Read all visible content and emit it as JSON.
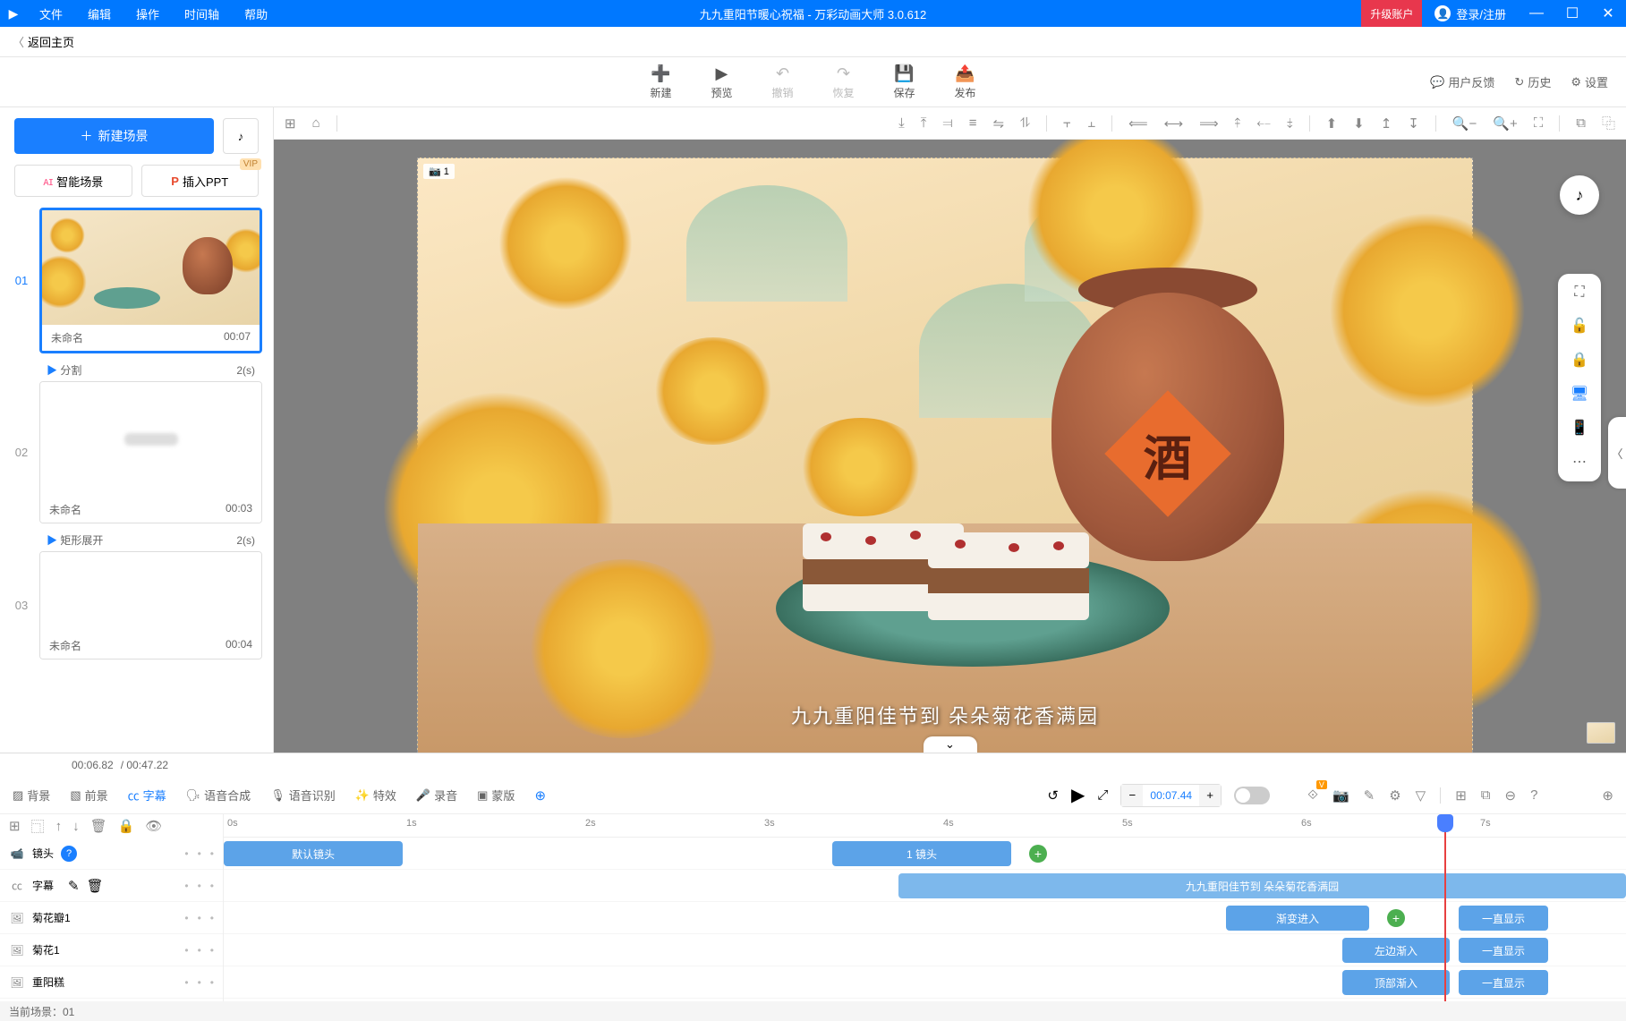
{
  "titlebar": {
    "menus": [
      "文件",
      "编辑",
      "操作",
      "时间轴",
      "帮助"
    ],
    "title": "九九重阳节暖心祝福 - 万彩动画大师 3.0.612",
    "upgrade": "升级账户",
    "login": "登录/注册"
  },
  "back": {
    "label": "返回主页"
  },
  "toolbar": {
    "new": "新建",
    "preview": "预览",
    "undo": "撤销",
    "redo": "恢复",
    "save": "保存",
    "publish": "发布",
    "feedback": "用户反馈",
    "history": "历史",
    "settings": "设置"
  },
  "left": {
    "new_scene": "新建场景",
    "smart_scene": "智能场景",
    "insert_ppt": "插入PPT",
    "vip": "VIP",
    "scenes": [
      {
        "idx": "01",
        "name": "未命名",
        "duration": "00:07",
        "selected": true,
        "blank": false,
        "transition": {
          "name": "分割",
          "duration": "2(s)"
        }
      },
      {
        "idx": "02",
        "name": "未命名",
        "duration": "00:03",
        "selected": false,
        "blank": true,
        "transition": {
          "name": "矩形展开",
          "duration": "2(s)"
        }
      },
      {
        "idx": "03",
        "name": "未命名",
        "duration": "00:04",
        "selected": false,
        "blank": true
      }
    ]
  },
  "canvas": {
    "camera_badge": "1",
    "caption": "九九重阳佳节到 朵朵菊花香满园",
    "jar_char": "酒"
  },
  "time_header": {
    "current": "00:06.82",
    "total": "/ 00:47.22"
  },
  "timeline": {
    "tabs": {
      "bg": "背景",
      "fg": "前景",
      "subtitle": "字幕",
      "tts": "语音合成",
      "asr": "语音识别",
      "fx": "特效",
      "record": "录音",
      "mask": "蒙版"
    },
    "time_value": "00:07.44",
    "ticks": [
      "0s",
      "1s",
      "2s",
      "3s",
      "4s",
      "5s",
      "6s",
      "7s"
    ],
    "tracks": {
      "camera": "镜头",
      "subtitle": "字幕",
      "l1": "菊花瓣1",
      "l2": "菊花1",
      "l3": "重阳糕"
    },
    "clips": {
      "default_cam": "默认镜头",
      "cam1": "1 镜头",
      "sub1": "九九重阳佳节到 朵朵菊花香满园",
      "fade_in": "渐变进入",
      "left_in": "左边渐入",
      "top_in": "顶部渐入",
      "always": "一直显示"
    }
  },
  "status": {
    "scene": "当前场景：01"
  }
}
